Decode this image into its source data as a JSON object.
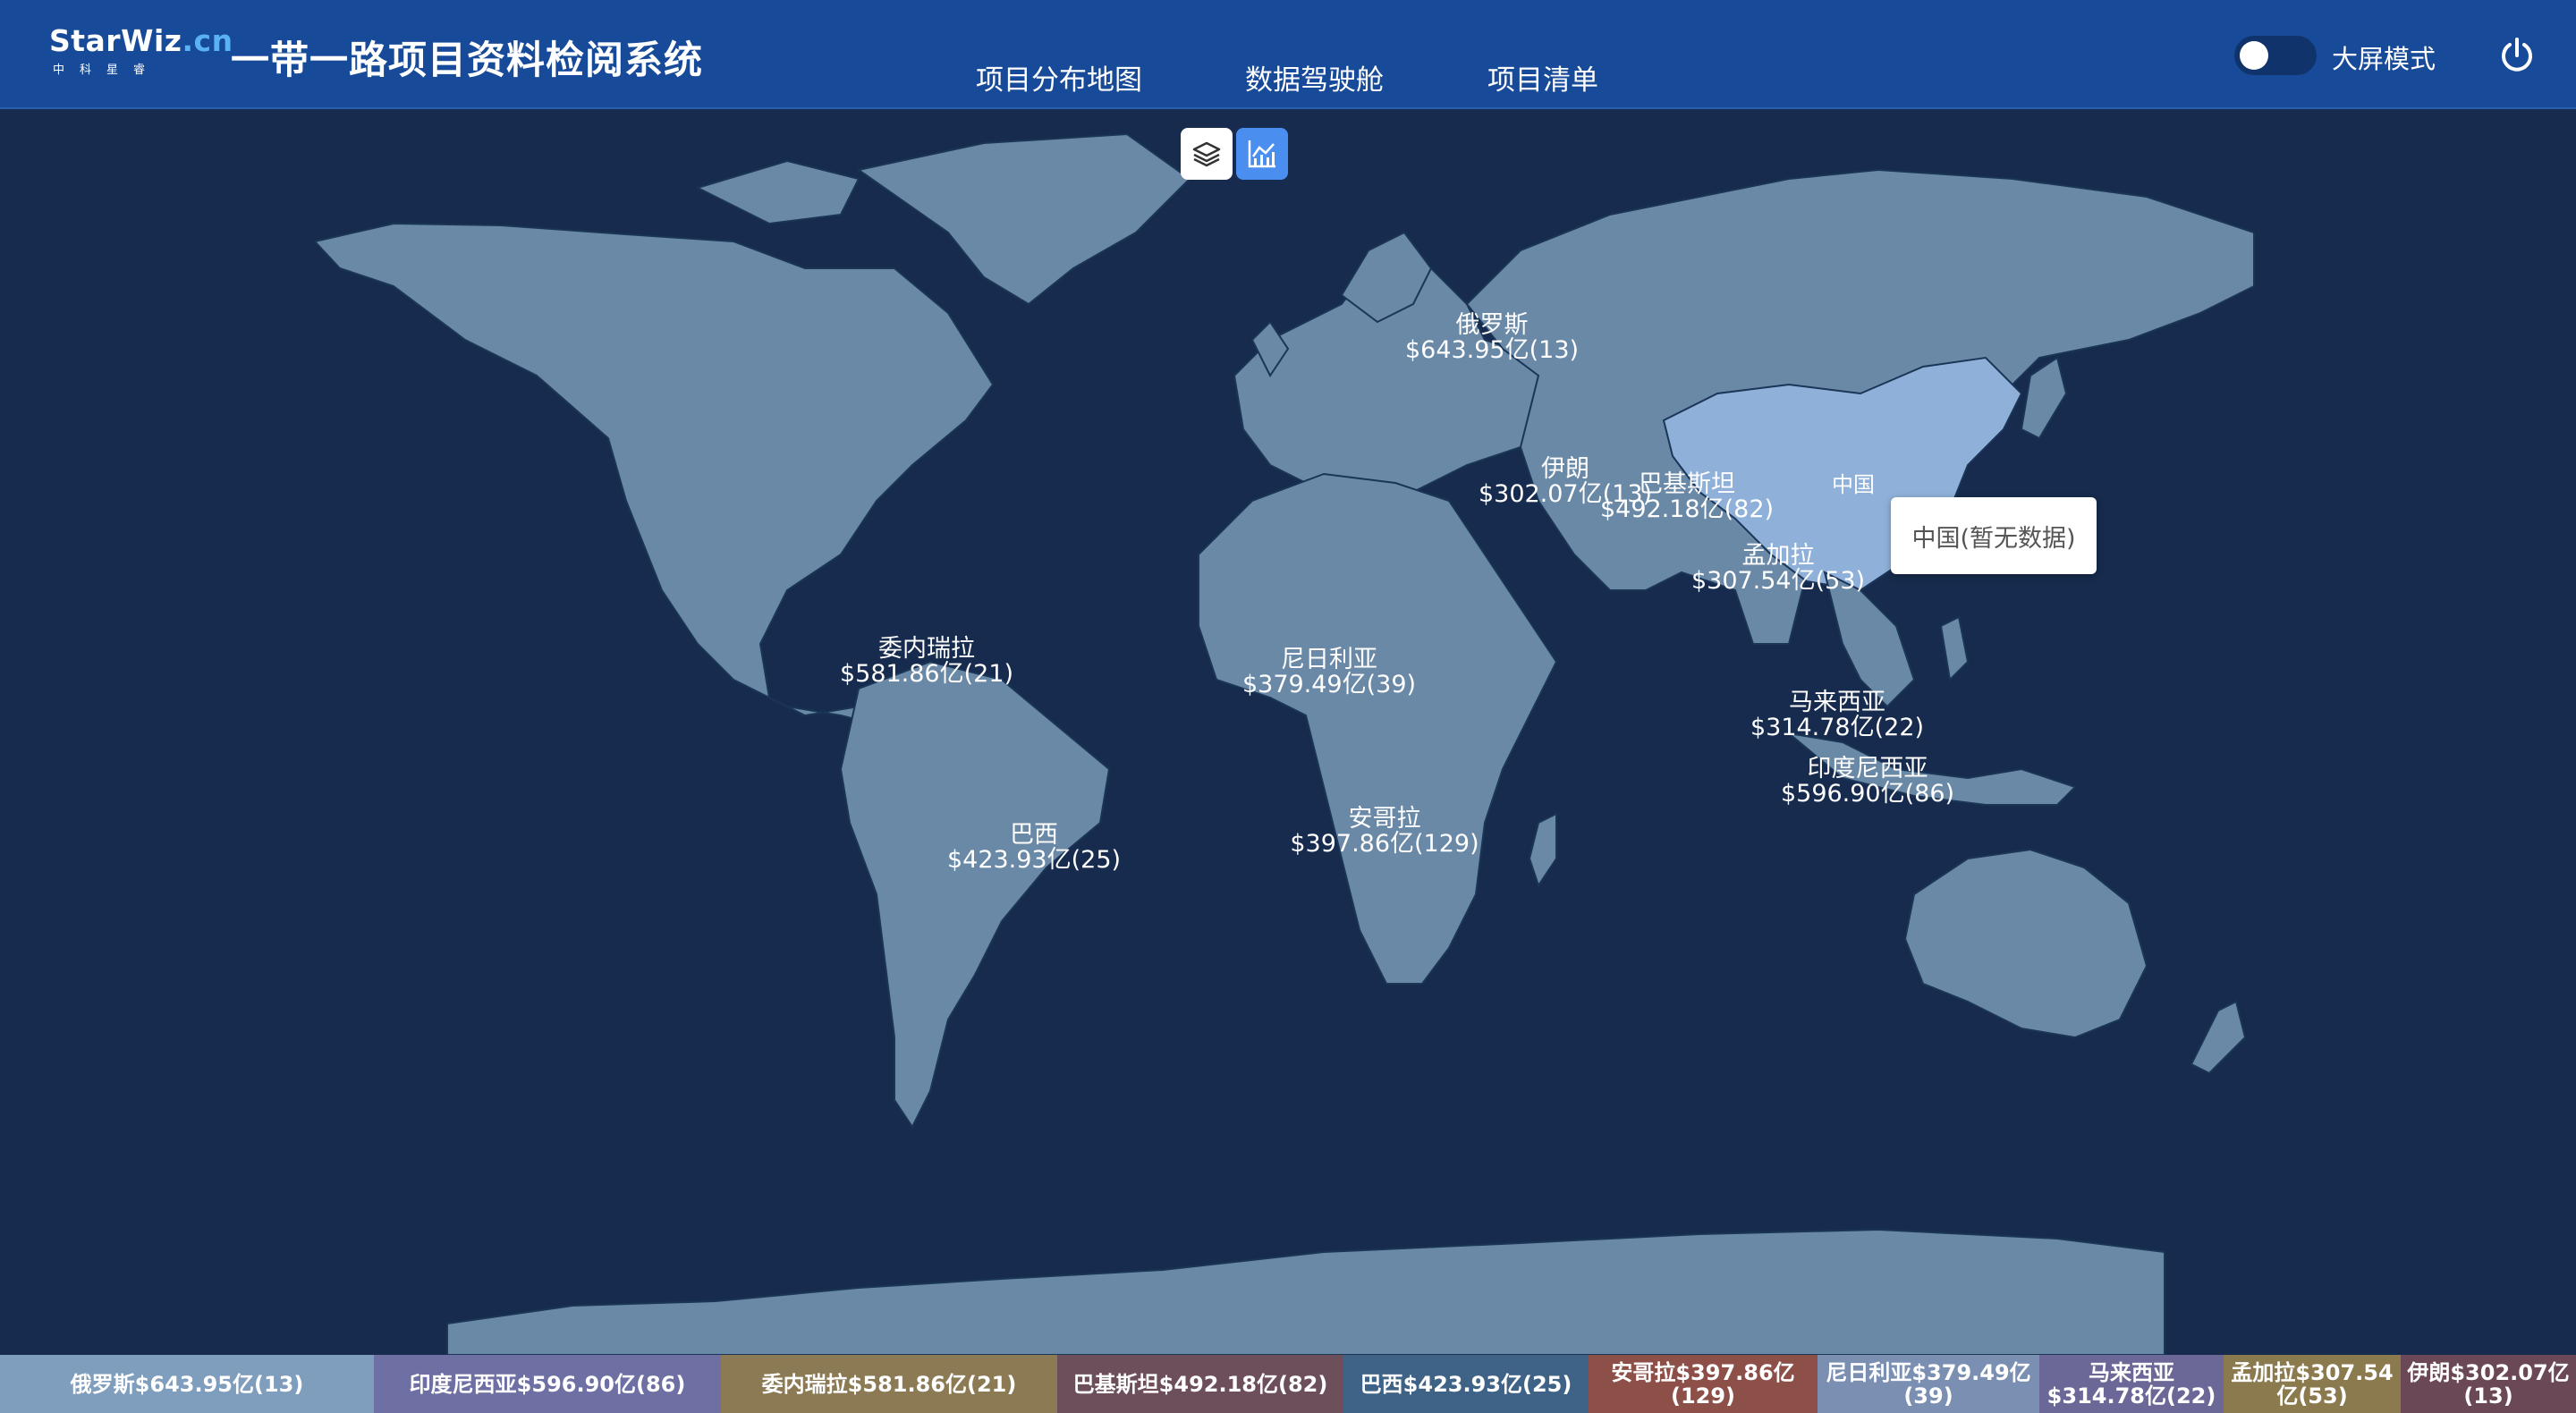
{
  "header": {
    "logo_main": "StarWiz",
    "logo_suffix": ".cn",
    "logo_sub": "中科星睿",
    "title": "一带一路项目资料检阅系统",
    "nav": [
      "项目分布地图",
      "数据驾驶舱",
      "项目清单"
    ],
    "bigscreen_label": "大屏模式",
    "bigscreen_on": false
  },
  "map": {
    "tools": [
      {
        "name": "layers-icon"
      },
      {
        "name": "chart-icon"
      }
    ],
    "labels": [
      {
        "country": "俄罗斯",
        "value": "$643.95亿(13)"
      },
      {
        "country": "伊朗",
        "value": "$302.07亿(13)"
      },
      {
        "country": "巴基斯坦",
        "value": "$492.18亿(82)"
      },
      {
        "country": "孟加拉",
        "value": "$307.54亿(53)"
      },
      {
        "country": "委内瑞拉",
        "value": "$581.86亿(21)"
      },
      {
        "country": "尼日利亚",
        "value": "$379.49亿(39)"
      },
      {
        "country": "马来西亚",
        "value": "$314.78亿(22)"
      },
      {
        "country": "印度尼西亚",
        "value": "$596.90亿(86)"
      },
      {
        "country": "巴西",
        "value": "$423.93亿(25)"
      },
      {
        "country": "安哥拉",
        "value": "$397.86亿(129)"
      }
    ],
    "china_label": "中国",
    "tooltip": "中国(暂无数据)"
  },
  "legend": [
    {
      "text": "俄罗斯$643.95亿(13)",
      "color": "#7f9dbd"
    },
    {
      "text": "印度尼西亚$596.90亿(86)",
      "color": "#6e6fa3"
    },
    {
      "text": "委内瑞拉$581.86亿(21)",
      "color": "#8b7a53"
    },
    {
      "text": "巴基斯坦$492.18亿(82)",
      "color": "#6d4f5b"
    },
    {
      "text": "巴西$423.93亿(25)",
      "color": "#3e6387"
    },
    {
      "text": "安哥拉$397.86亿(129)",
      "color": "#8c5049"
    },
    {
      "text": "尼日利亚$379.49亿(39)",
      "color": "#7a8fb2"
    },
    {
      "text": "马来西亚$314.78亿(22)",
      "color": "#6b6897"
    },
    {
      "text": "孟加拉$307.54亿(53)",
      "color": "#8c7a4f"
    },
    {
      "text": "伊朗$302.07亿(13)",
      "color": "#6b4855"
    }
  ]
}
